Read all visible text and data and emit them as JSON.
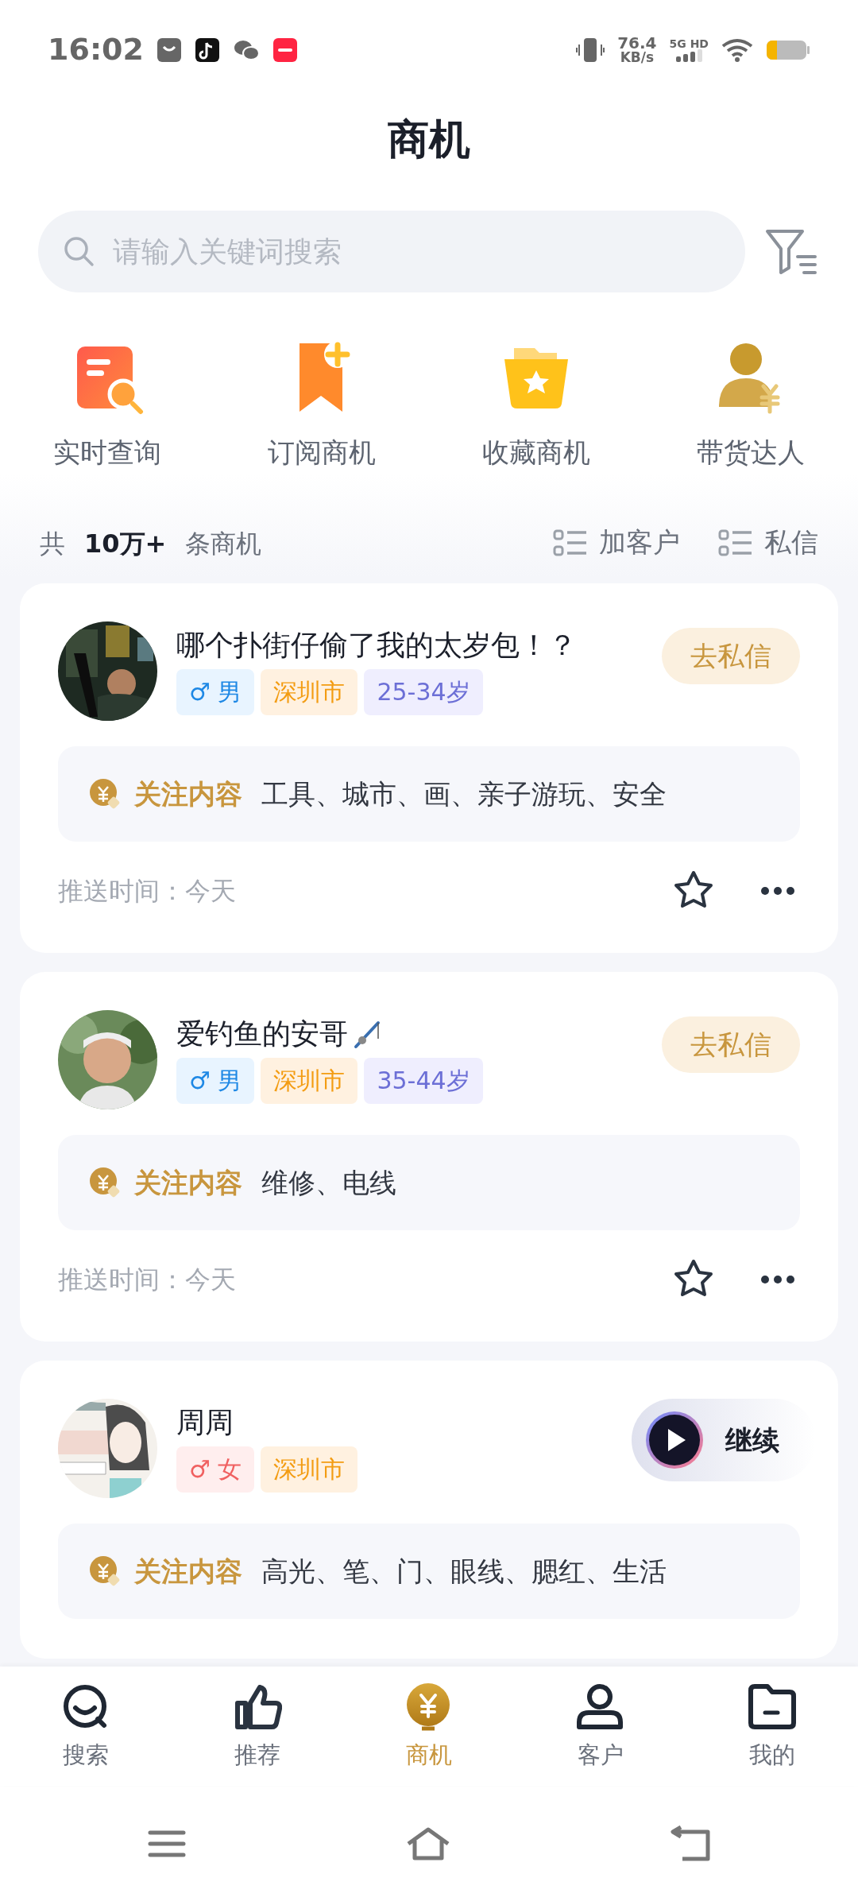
{
  "status_bar": {
    "time": "16:02",
    "net_speed": "76.4",
    "net_unit": "KB/s",
    "network": "5G HD"
  },
  "title": "商机",
  "search": {
    "placeholder": "请输入关键词搜索"
  },
  "quick_actions": [
    {
      "label": "实时查询",
      "kind": "query"
    },
    {
      "label": "订阅商机",
      "kind": "subscribe"
    },
    {
      "label": "收藏商机",
      "kind": "favorite"
    },
    {
      "label": "带货达人",
      "kind": "influencer"
    }
  ],
  "summary": {
    "prefix": "共",
    "count": "10万+",
    "suffix": "条商机",
    "actions": [
      "加客户",
      "私信"
    ]
  },
  "cards": [
    {
      "name": "哪个扑街仔偷了我的太岁包！？",
      "kind": "plain",
      "gender": {
        "kind": "male",
        "symbol": "♂",
        "label": "男"
      },
      "city": "深圳市",
      "age": "25-34岁",
      "action": {
        "kind": "message",
        "label": "去私信"
      },
      "interest_label": "关注内容",
      "interests": "工具、城市、画、亲子游玩、安全",
      "push_time": "推送时间：今天"
    },
    {
      "name": "爱钓鱼的安哥",
      "kind": "angler",
      "gender": {
        "kind": "male",
        "symbol": "♂",
        "label": "男"
      },
      "city": "深圳市",
      "age": "35-44岁",
      "action": {
        "kind": "message",
        "label": "去私信"
      },
      "interest_label": "关注内容",
      "interests": "维修、电线",
      "push_time": "推送时间：今天"
    },
    {
      "name": "周周",
      "kind": "plain",
      "gender": {
        "kind": "female",
        "symbol": "♂",
        "label": "女"
      },
      "city": "深圳市",
      "action": {
        "kind": "continue",
        "label": "继续"
      },
      "interest_label": "关注内容",
      "interests": "高光、笔、门、眼线、腮红、生活"
    }
  ],
  "nav": [
    {
      "label": "搜索",
      "kind": "search",
      "selected": false
    },
    {
      "label": "推荐",
      "kind": "like",
      "selected": false
    },
    {
      "label": "商机",
      "kind": "coin",
      "selected": true
    },
    {
      "label": "客户",
      "kind": "person",
      "selected": false
    },
    {
      "label": "我的",
      "kind": "folder",
      "selected": false
    }
  ]
}
